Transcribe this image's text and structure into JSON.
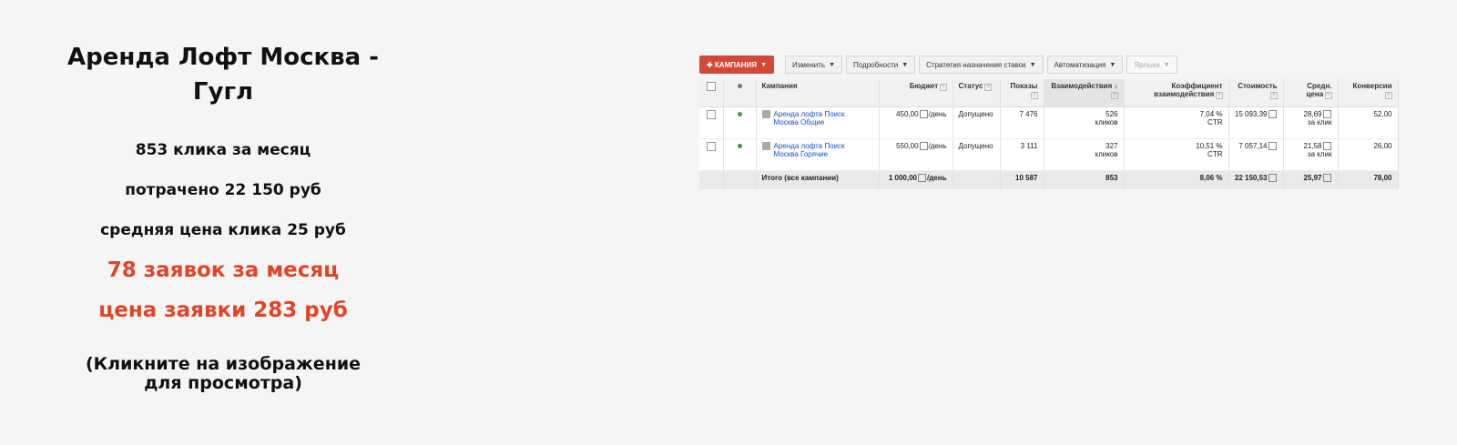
{
  "left": {
    "title_line1": "Аренда Лофт Москва -",
    "title_line2": "Гугл",
    "clicks": "853 клика за месяц",
    "spent": "потрачено 22 150 руб",
    "cpc": "средняя цена клика 25 руб",
    "leads": "78 заявок за месяц",
    "lead_price": "цена заявки 283 руб",
    "note_line1": "(Кликните на изображение",
    "note_line2": "для просмотра)"
  },
  "colors": {
    "accent": "#e0452a",
    "primary_button": "#d14836",
    "link": "#1a4fc9"
  },
  "toolbar": {
    "campaign_button": "✚ КАМПАНИЯ",
    "edit": "Изменить",
    "details": "Подробности",
    "bid_strategy": "Стратегия назначения ставок",
    "automation": "Автоматизация",
    "labels": "Ярлыки"
  },
  "table": {
    "headers": {
      "campaign": "Кампания",
      "budget": "Бюджет",
      "status": "Статус",
      "impressions": "Показы",
      "interactions": "Взаимодействия",
      "interaction_rate_1": "Коэффициент",
      "interaction_rate_2": "взаимодействия",
      "cost": "Стоимость",
      "avg_cpc_1": "Средн.",
      "avg_cpc_2": "цена",
      "conversions": "Конверсии"
    },
    "rows": [
      {
        "name_1": "Аренда лофта Поиск",
        "name_2": "Москва Общие",
        "budget": "450,00",
        "budget_unit": "/день",
        "status": "Допущено",
        "impressions": "7 476",
        "interactions": "526",
        "interactions_unit": "кликов",
        "rate": "7,04 %",
        "rate_unit": "CTR",
        "cost": "15 093,39",
        "avg_cpc": "28,69",
        "avg_cpc_unit": "за клик",
        "conversions": "52,00"
      },
      {
        "name_1": "Аренда лофта Поиск",
        "name_2": "Москва Горячие",
        "budget": "550,00",
        "budget_unit": "/день",
        "status": "Допущено",
        "impressions": "3 111",
        "interactions": "327",
        "interactions_unit": "кликов",
        "rate": "10,51 %",
        "rate_unit": "CTR",
        "cost": "7 057,14",
        "avg_cpc": "21,58",
        "avg_cpc_unit": "за клик",
        "conversions": "26,00"
      }
    ],
    "total": {
      "label": "Итого (все кампании)",
      "budget": "1 000,00",
      "budget_unit": "/день",
      "impressions": "10 587",
      "interactions": "853",
      "rate": "8,06 %",
      "cost": "22 150,53",
      "avg_cpc": "25,97",
      "conversions": "78,00"
    }
  }
}
